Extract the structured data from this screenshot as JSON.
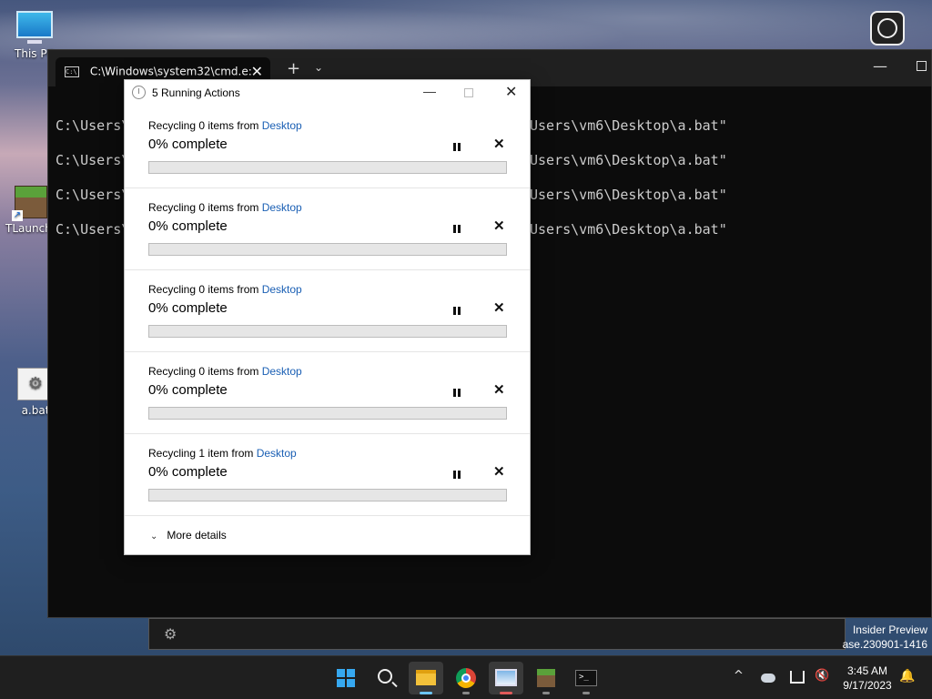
{
  "desktop": {
    "icons": [
      {
        "label": "This PC",
        "glyph": "monitor-icon"
      },
      {
        "label": "TLauncher",
        "glyph": "minecraft-icon"
      },
      {
        "label": "a.bat",
        "glyph": "bat-file-icon"
      }
    ]
  },
  "terminal": {
    "tab_title": "C:\\Windows\\system32\\cmd.e:",
    "tab_close": "✕",
    "new_tab": "+",
    "dropdown": "⌄",
    "minimize": "—",
    "cmd_icon_text": "C:\\",
    "lines_left": [
      "C:\\Users\\",
      "C:\\Users\\",
      "C:\\Users\\",
      "C:\\Users\\"
    ],
    "lines_right": [
      "Users\\vm6\\Desktop\\a.bat\"",
      "Users\\vm6\\Desktop\\a.bat\"",
      "Users\\vm6\\Desktop\\a.bat\"",
      "Users\\vm6\\Desktop\\a.bat\""
    ],
    "settings_glyph": "⚙"
  },
  "dialog": {
    "title": "5 Running Actions",
    "minimize": "—",
    "close": "✕",
    "actions": [
      {
        "prefix": "Recycling 0 items from ",
        "location": "Desktop",
        "status": "0% complete",
        "progress": 0
      },
      {
        "prefix": "Recycling 0 items from ",
        "location": "Desktop",
        "status": "0% complete",
        "progress": 0
      },
      {
        "prefix": "Recycling 0 items from ",
        "location": "Desktop",
        "status": "0% complete",
        "progress": 0
      },
      {
        "prefix": "Recycling 0 items from ",
        "location": "Desktop",
        "status": "0% complete",
        "progress": 0
      },
      {
        "prefix": "Recycling 1 item from ",
        "location": "Desktop",
        "status": "0% complete",
        "progress": 0
      }
    ],
    "cancel_glyph": "✕",
    "more_details": "More details",
    "chevron": "⌄"
  },
  "watermark": {
    "line1": "Insider Preview",
    "line2": "ase.230901-1416"
  },
  "taskbar": {
    "clock_time": "3:45 AM",
    "clock_date": "9/17/2023",
    "tray_chevron": "^",
    "volume_glyph": "🔇",
    "bell_glyph": "🔔"
  },
  "colors": {
    "accent": "#1a5fb4",
    "progress_fill": "#06b025",
    "terminal_bg": "#0c0c0c"
  }
}
